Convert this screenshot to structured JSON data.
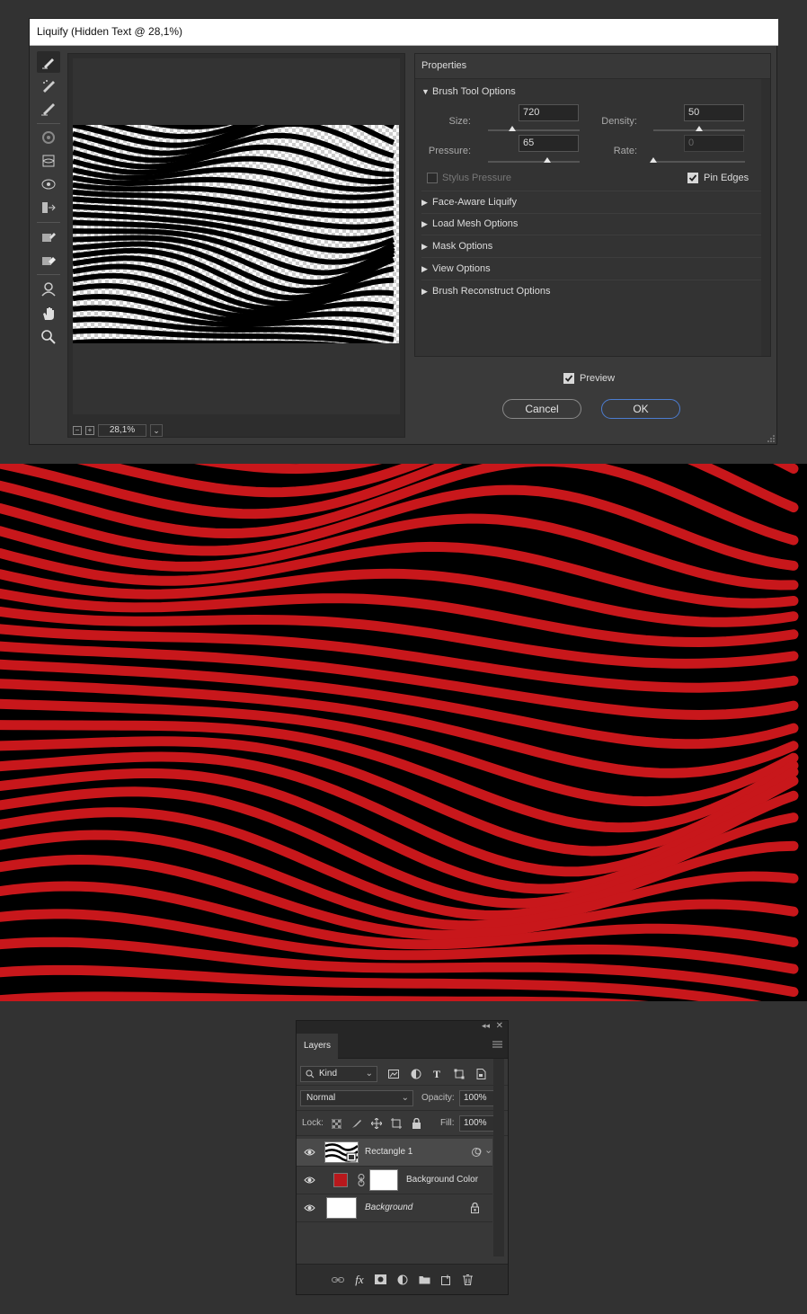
{
  "liquify": {
    "title": "Liquify (Hidden Text @ 28,1%)",
    "tools": [
      "forward-warp",
      "reconstruct",
      "smooth",
      "twirl-clockwise",
      "pucker",
      "bloat",
      "push-left",
      "freeze-mask",
      "thaw-mask",
      "face",
      "hand",
      "zoom"
    ],
    "zoom": {
      "value": "28,1%",
      "minus": "−",
      "plus": "+"
    },
    "properties": {
      "title": "Properties",
      "brush_section": "Brush Tool Options",
      "size_label": "Size:",
      "size_value": "720",
      "size_fraction": 0.26,
      "density_label": "Density:",
      "density_value": "50",
      "density_fraction": 0.5,
      "pressure_label": "Pressure:",
      "pressure_value": "65",
      "pressure_fraction": 0.65,
      "rate_label": "Rate:",
      "rate_value": "0",
      "rate_fraction": 0.0,
      "stylus_label": "Stylus Pressure",
      "stylus_checked": false,
      "pin_edges_label": "Pin Edges",
      "pin_edges_checked": true,
      "sections": [
        "Face-Aware Liquify",
        "Load Mesh Options",
        "Mask Options",
        "View Options",
        "Brush Reconstruct Options"
      ]
    },
    "preview_label": "Preview",
    "preview_checked": true,
    "cancel_label": "Cancel",
    "ok_label": "OK"
  },
  "artwork": {
    "stripe_color": "#c8171b",
    "background_color": "#000000"
  },
  "layers": {
    "tab_label": "Layers",
    "filter_kind": "Kind",
    "blend_mode": "Normal",
    "opacity_label": "Opacity:",
    "opacity_value": "100%",
    "lock_label": "Lock:",
    "fill_label": "Fill:",
    "fill_value": "100%",
    "items": [
      {
        "name": "Rectangle 1",
        "selected": true
      },
      {
        "name": "Background Color",
        "swatch": "#b8181c"
      },
      {
        "name": "Background",
        "locked": true
      }
    ]
  }
}
